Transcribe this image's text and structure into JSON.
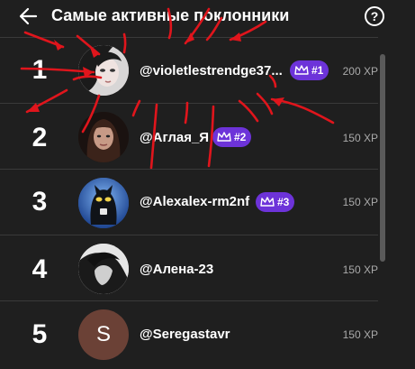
{
  "header": {
    "title": "Самые активные поклонники",
    "back_icon": "arrow-left-icon",
    "help_label": "?"
  },
  "fans": [
    {
      "rank": "1",
      "username": "@violetlestrendge37...",
      "badge": "#1",
      "xp": "200 XP"
    },
    {
      "rank": "2",
      "username": "@Аглая_Я",
      "badge": "#2",
      "xp": "150 XP"
    },
    {
      "rank": "3",
      "username": "@Alexalex-rm2nf",
      "badge": "#3",
      "xp": "150 XP"
    },
    {
      "rank": "4",
      "username": "@Алена-23",
      "badge": "",
      "xp": "150 XP"
    },
    {
      "rank": "5",
      "username": "@Seregastavr",
      "badge": "",
      "xp": "150 XP",
      "avatar_letter": "S"
    }
  ],
  "colors": {
    "badge": "#6d33d9",
    "annotation": "#e0151c",
    "background": "#1f1f1f"
  }
}
